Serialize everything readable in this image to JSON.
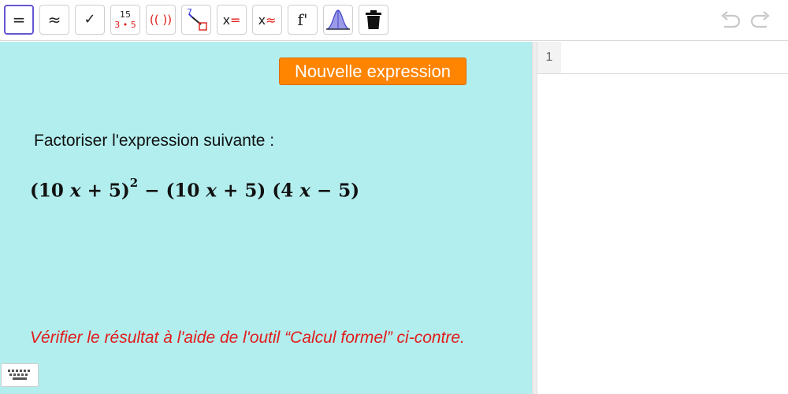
{
  "toolbar": {
    "tools": {
      "evaluate": "=",
      "numeric": "≈",
      "keep_input": "✓",
      "factor_top": "15",
      "factor_bottom": "3 • 5",
      "expand": "(( ))",
      "substitute_num": "7",
      "solve": "x=",
      "solve_numeric": "x≈",
      "derivative": "f'"
    },
    "selected_tool": "evaluate"
  },
  "graphics": {
    "background_color": "#b2eeee",
    "button_label": "Nouvelle expression",
    "button_color": "#ff8400",
    "instruction": "Factoriser l'expression suivante :",
    "hint": "Vérifier le résultat à l'aide de l'outil “Calcul formel” ci-contre.",
    "hint_color": "#e31b1b"
  },
  "expression": {
    "part1_open": "(10 ",
    "var": "x",
    "part1_close": " + 5)",
    "exponent": "2",
    "minus": " − (10 ",
    "part2_close": " + 5)  (4 ",
    "part3_close": " − 5)"
  },
  "cas": {
    "row_number": "1",
    "input_value": ""
  },
  "icons": {
    "keyboard": "keyboard-icon",
    "undo": "undo-icon",
    "redo": "redo-icon",
    "delete": "trash-icon",
    "probability": "normal-distribution-icon"
  }
}
